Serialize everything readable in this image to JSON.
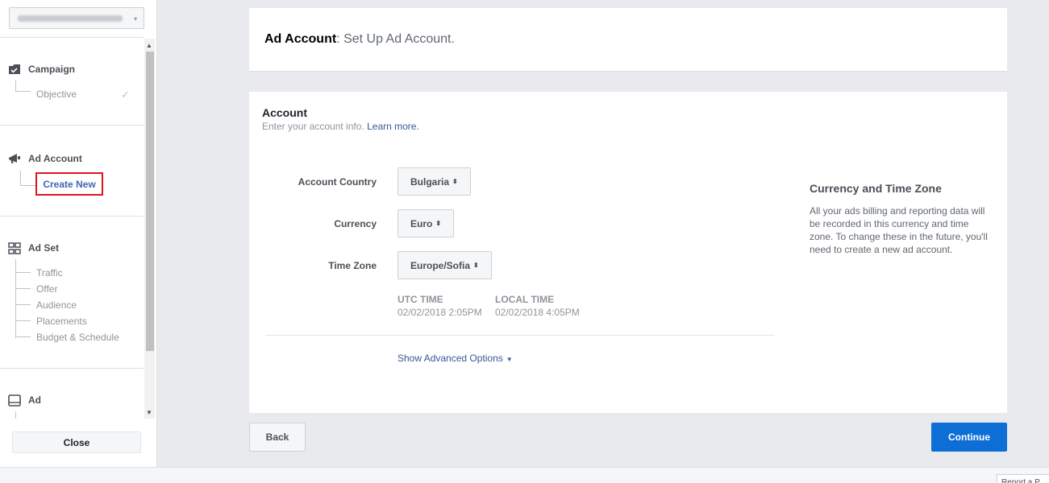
{
  "sidebar": {
    "account_selector_caret": "▾",
    "sections": [
      {
        "label": "Campaign",
        "icon": "campaign-icon",
        "items": [
          "Objective"
        ]
      },
      {
        "label": "Ad Account",
        "icon": "megaphone-icon",
        "items": [
          "Create New"
        ]
      },
      {
        "label": "Ad Set",
        "icon": "grid-icon",
        "items": [
          "Traffic",
          "Offer",
          "Audience",
          "Placements",
          "Budget & Schedule"
        ]
      },
      {
        "label": "Ad",
        "icon": "ad-icon",
        "items": []
      }
    ],
    "close_label": "Close"
  },
  "header": {
    "title_strong": "Ad Account",
    "title_rest": ": Set Up Ad Account."
  },
  "account": {
    "title": "Account",
    "subtitle": "Enter your account info.",
    "learn_more": "Learn more.",
    "country_label": "Account Country",
    "country_value": "Bulgaria",
    "currency_label": "Currency",
    "currency_value": "Euro",
    "timezone_label": "Time Zone",
    "timezone_value": "Europe/Sofia",
    "utc_label": "UTC TIME",
    "utc_value": "02/02/2018 2:05PM",
    "local_label": "LOCAL TIME",
    "local_value": "02/02/2018 4:05PM",
    "advanced": "Show Advanced Options"
  },
  "info": {
    "title": "Currency and Time Zone",
    "body": "All your ads billing and reporting data will be recorded in this currency and time zone. To change these in the future, you'll need to create a new ad account."
  },
  "footer": {
    "back": "Back",
    "continue": "Continue",
    "corner": "Report a P"
  },
  "colors": {
    "primary": "#0d6fd6",
    "link": "#365899",
    "highlight": "#e0141e"
  }
}
